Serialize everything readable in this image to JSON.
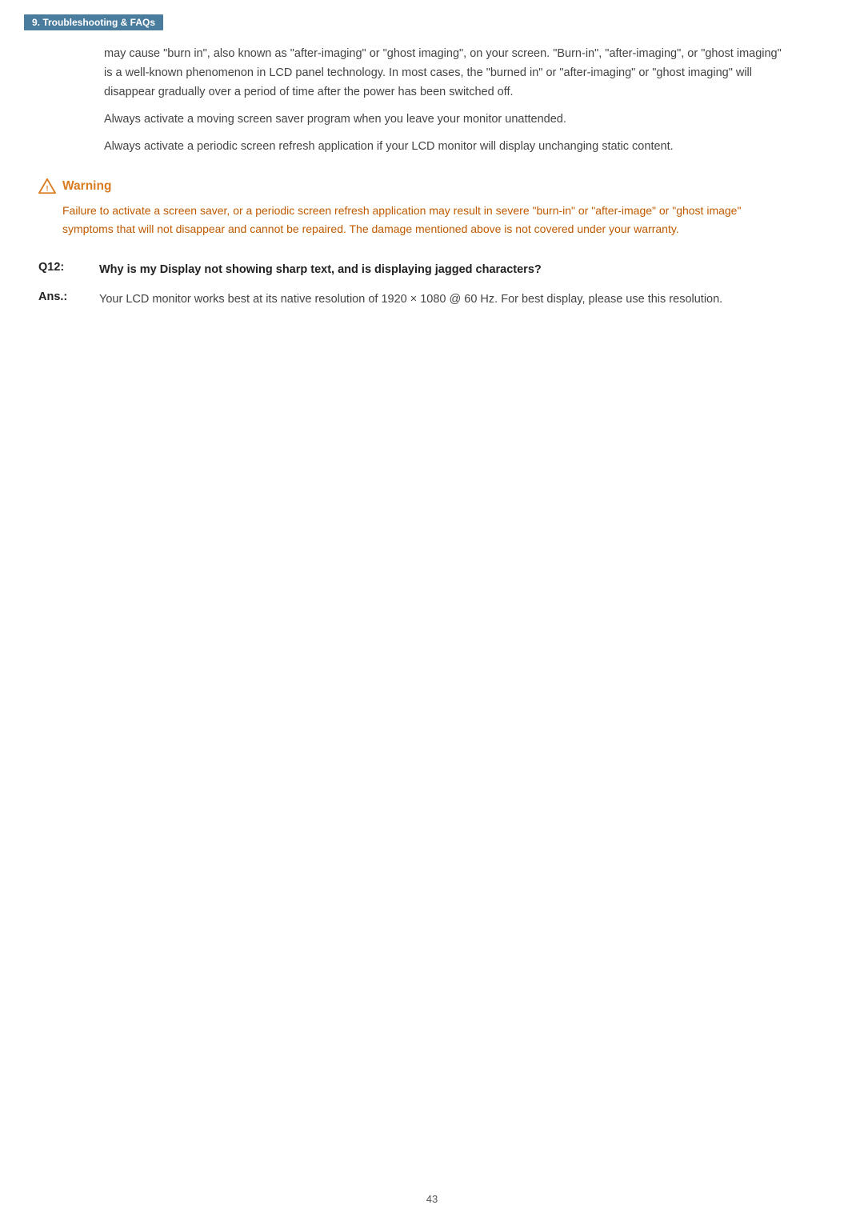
{
  "header": {
    "section_label": "9. Troubleshooting & FAQs"
  },
  "intro_paragraphs": [
    "may cause \"burn in\", also known as \"after-imaging\" or \"ghost imaging\", on your screen. \"Burn-in\", \"after-imaging\", or \"ghost imaging\" is a well-known phenomenon in LCD panel technology. In most cases, the \"burned in\" or \"after-imaging\" or \"ghost imaging\" will disappear gradually over a period of time after the power has been switched off.",
    "Always activate a moving screen saver program when you leave your monitor unattended.",
    "Always activate a periodic screen refresh application if your LCD monitor will display unchanging static content."
  ],
  "warning": {
    "title": "Warning",
    "icon_label": "warning-triangle-icon",
    "text": "Failure to activate a screen saver, or a periodic screen refresh application may result in severe \"burn-in\" or \"after-image\" or \"ghost image\" symptoms that will not disappear and cannot be repaired. The damage mentioned above is not covered under your warranty."
  },
  "qa": [
    {
      "question_label": "Q12:",
      "question": "Why is my Display not showing sharp text, and is displaying jagged characters?",
      "answer_label": "Ans.:",
      "answer": "Your LCD monitor works best at its native resolution of 1920 × 1080 @ 60 Hz. For best display, please use this resolution."
    }
  ],
  "page_number": "43"
}
